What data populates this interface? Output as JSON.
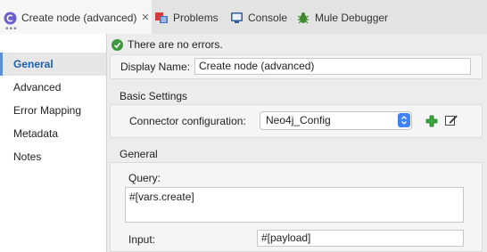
{
  "tabs": [
    {
      "label": "Create node (advanced)",
      "close": "✕",
      "icon": "mule-component-icon"
    },
    {
      "label": "Problems",
      "icon": "problems-icon"
    },
    {
      "label": "Console",
      "icon": "console-icon"
    },
    {
      "label": "Mule Debugger",
      "icon": "debugger-bug-icon"
    }
  ],
  "sidebar": {
    "items": [
      {
        "label": "General",
        "active": true
      },
      {
        "label": "Advanced"
      },
      {
        "label": "Error Mapping"
      },
      {
        "label": "Metadata"
      },
      {
        "label": "Notes"
      }
    ]
  },
  "status": {
    "text": "There are no errors.",
    "color": "#3c9a3c"
  },
  "display_name": {
    "label": "Display Name:",
    "value": "Create node (advanced)"
  },
  "basic_settings": {
    "title": "Basic Settings",
    "connector_label": "Connector configuration:",
    "connector_value": "Neo4j_Config"
  },
  "general_section": {
    "title": "General",
    "query_label": "Query:",
    "query_value": "#[vars.create]",
    "input_label": "Input:",
    "input_value": "#[payload]"
  },
  "colors": {
    "accent": "#3f82f7",
    "selected_text": "#1d5fa8",
    "add_green": "#3aa53a"
  }
}
